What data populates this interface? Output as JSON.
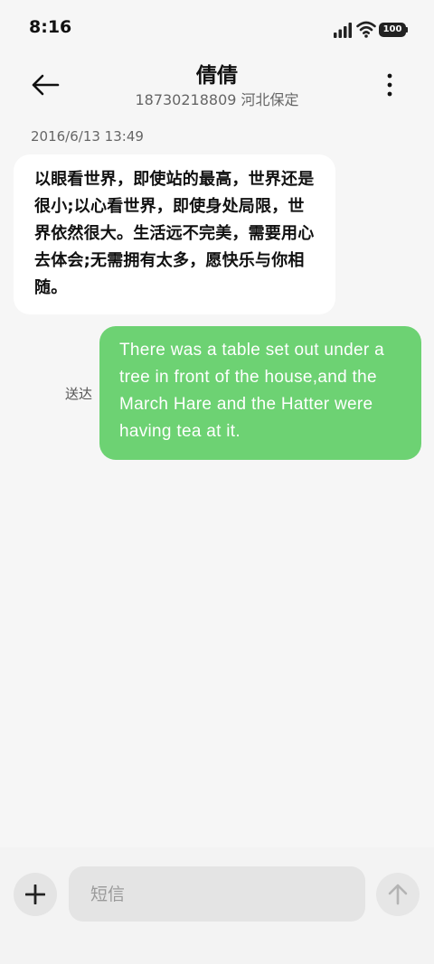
{
  "status_bar": {
    "time": "8:16",
    "battery": "100",
    "icons": [
      "signal-icon",
      "wifi-icon",
      "battery-icon"
    ]
  },
  "header": {
    "contact_name": "倩倩",
    "contact_detail": "18730218809 河北保定",
    "icons": [
      "back-arrow-icon",
      "more-vertical-icon"
    ]
  },
  "conversation": {
    "timestamp": "2016/6/13 13:49",
    "messages": [
      {
        "direction": "incoming",
        "text": "以眼看世界，即使站的最高，世界还是很小;以心看世界，即使身处局限，世界依然很大。生活远不完美，需要用心去体会;无需拥有太多，愿快乐与你相随。"
      },
      {
        "direction": "outgoing",
        "text": "There was a table set out under a tree in front of the house,and the March Hare and the Hatter were having tea at it.",
        "status": "送达"
      }
    ]
  },
  "composer": {
    "placeholder": "短信",
    "value": "",
    "icons": [
      "plus-icon",
      "send-arrow-icon"
    ]
  },
  "colors": {
    "background": "#f6f6f6",
    "incoming_bubble": "#ffffff",
    "outgoing_bubble": "#6dd273",
    "input_background": "#e4e4e4"
  }
}
